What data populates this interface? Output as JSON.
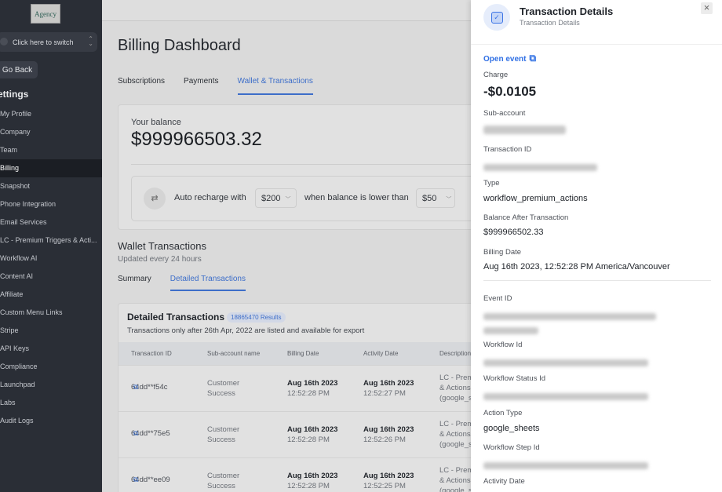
{
  "sidebar": {
    "logo_text": "Agency",
    "switcher_label": "Click here to switch",
    "go_back": "Go Back",
    "section": "ettings",
    "items": [
      "My Profile",
      "Company",
      "Team",
      "Billing",
      "Snapshot",
      "Phone Integration",
      "Email Services",
      "LC - Premium Triggers & Acti...",
      "Workflow AI",
      "Content AI",
      "Affiliate",
      "Custom Menu Links",
      "Stripe",
      "API Keys",
      "Compliance",
      "Launchpad",
      "Labs",
      "Audit Logs"
    ],
    "active_index": 3
  },
  "main": {
    "title": "Billing Dashboard",
    "tabs": [
      "Subscriptions",
      "Payments",
      "Wallet & Transactions"
    ],
    "balance_label": "Your balance",
    "balance_value": "$999966503.32",
    "recharge": {
      "text1": "Auto recharge with",
      "amount": "$200",
      "text2": "when balance is lower than",
      "threshold": "$50"
    },
    "wallet_title": "Wallet Transactions",
    "wallet_sub": "Updated every 24 hours",
    "subtabs": [
      "Summary",
      "Detailed Transactions"
    ],
    "table": {
      "title": "Detailed Transactions",
      "badge": "18865470 Results",
      "note": "Transactions only after 26th Apr, 2022 are listed and available for export",
      "headers": [
        "Transaction ID",
        "Sub-account name",
        "Billing Date",
        "Activity Date",
        "Description"
      ],
      "rows": [
        {
          "id": "64dd**f54c",
          "sub1": "Customer",
          "sub2": "Success",
          "bdate": "Aug 16th 2023",
          "btime": "12:52:28 PM",
          "adate": "Aug 16th 2023",
          "atime": "12:52:27 PM",
          "d1": "LC - Prem",
          "d2": "& Actions",
          "d3": "(google_s"
        },
        {
          "id": "64dd**75e5",
          "sub1": "Customer",
          "sub2": "Success",
          "bdate": "Aug 16th 2023",
          "btime": "12:52:28 PM",
          "adate": "Aug 16th 2023",
          "atime": "12:52:26 PM",
          "d1": "LC - Prem",
          "d2": "& Actions",
          "d3": "(google_s"
        },
        {
          "id": "64dd**ee09",
          "sub1": "Customer",
          "sub2": "Success",
          "bdate": "Aug 16th 2023",
          "btime": "12:52:28 PM",
          "adate": "Aug 16th 2023",
          "atime": "12:52:25 PM",
          "d1": "LC - Prem",
          "d2": "& Actions",
          "d3": "(google_s"
        }
      ]
    }
  },
  "panel": {
    "title": "Transaction Details",
    "subtitle": "Transaction Details",
    "open_event": "Open event",
    "charge_label": "Charge",
    "charge": "-$0.0105",
    "subaccount_label": "Sub-account",
    "txid_label": "Transaction ID",
    "type_label": "Type",
    "type": "workflow_premium_actions",
    "balance_after_label": "Balance After Transaction",
    "balance_after": "$999966502.33",
    "billing_date_label": "Billing Date",
    "billing_date": "Aug 16th 2023, 12:52:28 PM America/Vancouver",
    "event_id_label": "Event ID",
    "workflow_id_label": "Workflow Id",
    "workflow_status_label": "Workflow Status Id",
    "action_type_label": "Action Type",
    "action_type": "google_sheets",
    "workflow_step_label": "Workflow Step Id",
    "activity_date_label": "Activity Date"
  },
  "colors": {
    "accent": "#2f6fe4",
    "sidebar": "#2a2e36"
  }
}
